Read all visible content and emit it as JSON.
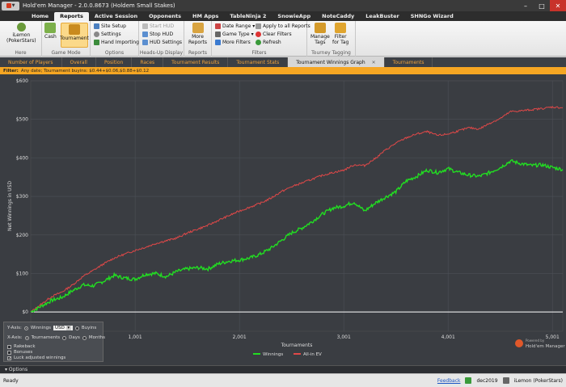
{
  "window": {
    "title": "Hold'em Manager - 2.0.0.8673 (Holdem Small Stakes)"
  },
  "menu": {
    "tabs": [
      "Home",
      "Reports",
      "Active Session",
      "Opponents",
      "HM Apps",
      "TableNinja 2",
      "SnowieApp",
      "NoteCaddy",
      "LeakBuster",
      "SHNGo Wizard"
    ],
    "active": "Reports"
  },
  "ribbon": {
    "here": {
      "player": "iLemon",
      "site": "(PokerStars)",
      "group": "Here"
    },
    "game_mode": {
      "cash": "Cash",
      "tournament": "Tournament",
      "group": "Game Mode"
    },
    "options": {
      "site_setup": "Site Setup",
      "settings": "Settings",
      "hand_importing": "Hand Importing",
      "group": "Options"
    },
    "hud": {
      "start": "Start HUD",
      "stop": "Stop HUD",
      "settings": "HUD Settings",
      "group": "Heads-Up Display"
    },
    "reports": {
      "more_reports_1": "More",
      "more_reports_2": "Reports",
      "group": "Reports"
    },
    "filters": {
      "date_range": "Date Range",
      "game_type": "Game Type",
      "more_filters": "More Filters",
      "apply_all": "Apply to all Reports",
      "clear": "Clear Filters",
      "refresh": "Refresh",
      "group": "Filters"
    },
    "tourney": {
      "manage_1": "Manage",
      "manage_2": "Tags",
      "filter_1": "Filter",
      "filter_2": "for Tag",
      "group": "Tourney Tagging"
    }
  },
  "report_tabs": [
    "Number of Players",
    "Overall",
    "Position",
    "Races",
    "Tournament Results",
    "Tournament Stats",
    "Tournament Winnings Graph",
    "Tournaments"
  ],
  "active_report_tab": "Tournament Winnings Graph",
  "filter": {
    "label": "Filter:",
    "text": "Any date; Tournament buyins: $0.44+$0.06,$0.88+$0.12"
  },
  "chart_data": {
    "type": "line",
    "xlabel": "Tournaments",
    "ylabel": "Net Winnings in USD",
    "xlim": [
      0,
      5100
    ],
    "ylim": [
      -50,
      600
    ],
    "x_ticks": [
      "1,001",
      "2,001",
      "3,001",
      "4,001",
      "5,001"
    ],
    "x_tick_values": [
      1001,
      2001,
      3001,
      4001,
      5001
    ],
    "y_ticks": [
      "$0",
      "$100",
      "$200",
      "$300",
      "$400",
      "$500",
      "$600"
    ],
    "y_tick_values": [
      0,
      100,
      200,
      300,
      400,
      500,
      600
    ],
    "series": [
      {
        "name": "Winnings",
        "color": "#22dd22",
        "x": [
          0,
          100,
          200,
          300,
          400,
          500,
          600,
          700,
          800,
          900,
          1000,
          1100,
          1200,
          1300,
          1400,
          1500,
          1600,
          1700,
          1800,
          1900,
          2000,
          2100,
          2200,
          2300,
          2400,
          2500,
          2600,
          2700,
          2800,
          2900,
          3000,
          3100,
          3200,
          3300,
          3400,
          3500,
          3600,
          3700,
          3800,
          3900,
          4000,
          4100,
          4200,
          4300,
          4400,
          4500,
          4600,
          4700,
          4800,
          4900,
          5000,
          5100
        ],
        "values": [
          0,
          15,
          30,
          38,
          55,
          70,
          68,
          80,
          95,
          88,
          85,
          98,
          100,
          92,
          105,
          112,
          115,
          112,
          125,
          132,
          135,
          140,
          150,
          165,
          185,
          205,
          218,
          235,
          255,
          270,
          275,
          285,
          262,
          282,
          298,
          312,
          340,
          352,
          368,
          362,
          372,
          362,
          355,
          352,
          362,
          375,
          392,
          385,
          380,
          382,
          375,
          370
        ]
      },
      {
        "name": "All-in EV",
        "color": "#e04848",
        "x": [
          0,
          100,
          200,
          300,
          400,
          500,
          600,
          700,
          800,
          900,
          1000,
          1100,
          1200,
          1300,
          1400,
          1500,
          1600,
          1700,
          1800,
          1900,
          2000,
          2100,
          2200,
          2300,
          2400,
          2500,
          2600,
          2700,
          2800,
          2900,
          3000,
          3100,
          3200,
          3300,
          3400,
          3500,
          3600,
          3700,
          3800,
          3900,
          4000,
          4100,
          4200,
          4300,
          4400,
          4500,
          4600,
          4700,
          4800,
          4900,
          5000,
          5100
        ],
        "values": [
          0,
          20,
          40,
          52,
          70,
          92,
          108,
          125,
          140,
          150,
          160,
          168,
          178,
          185,
          192,
          205,
          215,
          225,
          238,
          250,
          262,
          272,
          282,
          295,
          312,
          325,
          335,
          345,
          355,
          362,
          368,
          382,
          380,
          398,
          420,
          438,
          452,
          462,
          468,
          458,
          462,
          470,
          478,
          475,
          490,
          502,
          520,
          522,
          525,
          528,
          532,
          530
        ]
      }
    ],
    "zero_line": true,
    "legend_placement": "bottom-center",
    "grid": true
  },
  "axis_options": {
    "y_axis_label": "Y-Axis:",
    "y_winnings": "Winnings",
    "currency": "USD",
    "y_buyins": "Buyins",
    "x_axis_label": "X-Axis:",
    "x_tournaments": "Tournaments",
    "x_days": "Days",
    "x_months": "Months",
    "rakeback": "Rakeback",
    "bonuses": "Bonuses",
    "luck_adjusted": "Luck adjusted winnings"
  },
  "watermark": {
    "line1": "Powered by",
    "line2": "Hold'em Manager"
  },
  "options_bar": {
    "label": "Options"
  },
  "status": {
    "ready": "Ready",
    "feedback": "Feedback",
    "database": "dec2019",
    "player": "iLemon (PokerStars)"
  }
}
